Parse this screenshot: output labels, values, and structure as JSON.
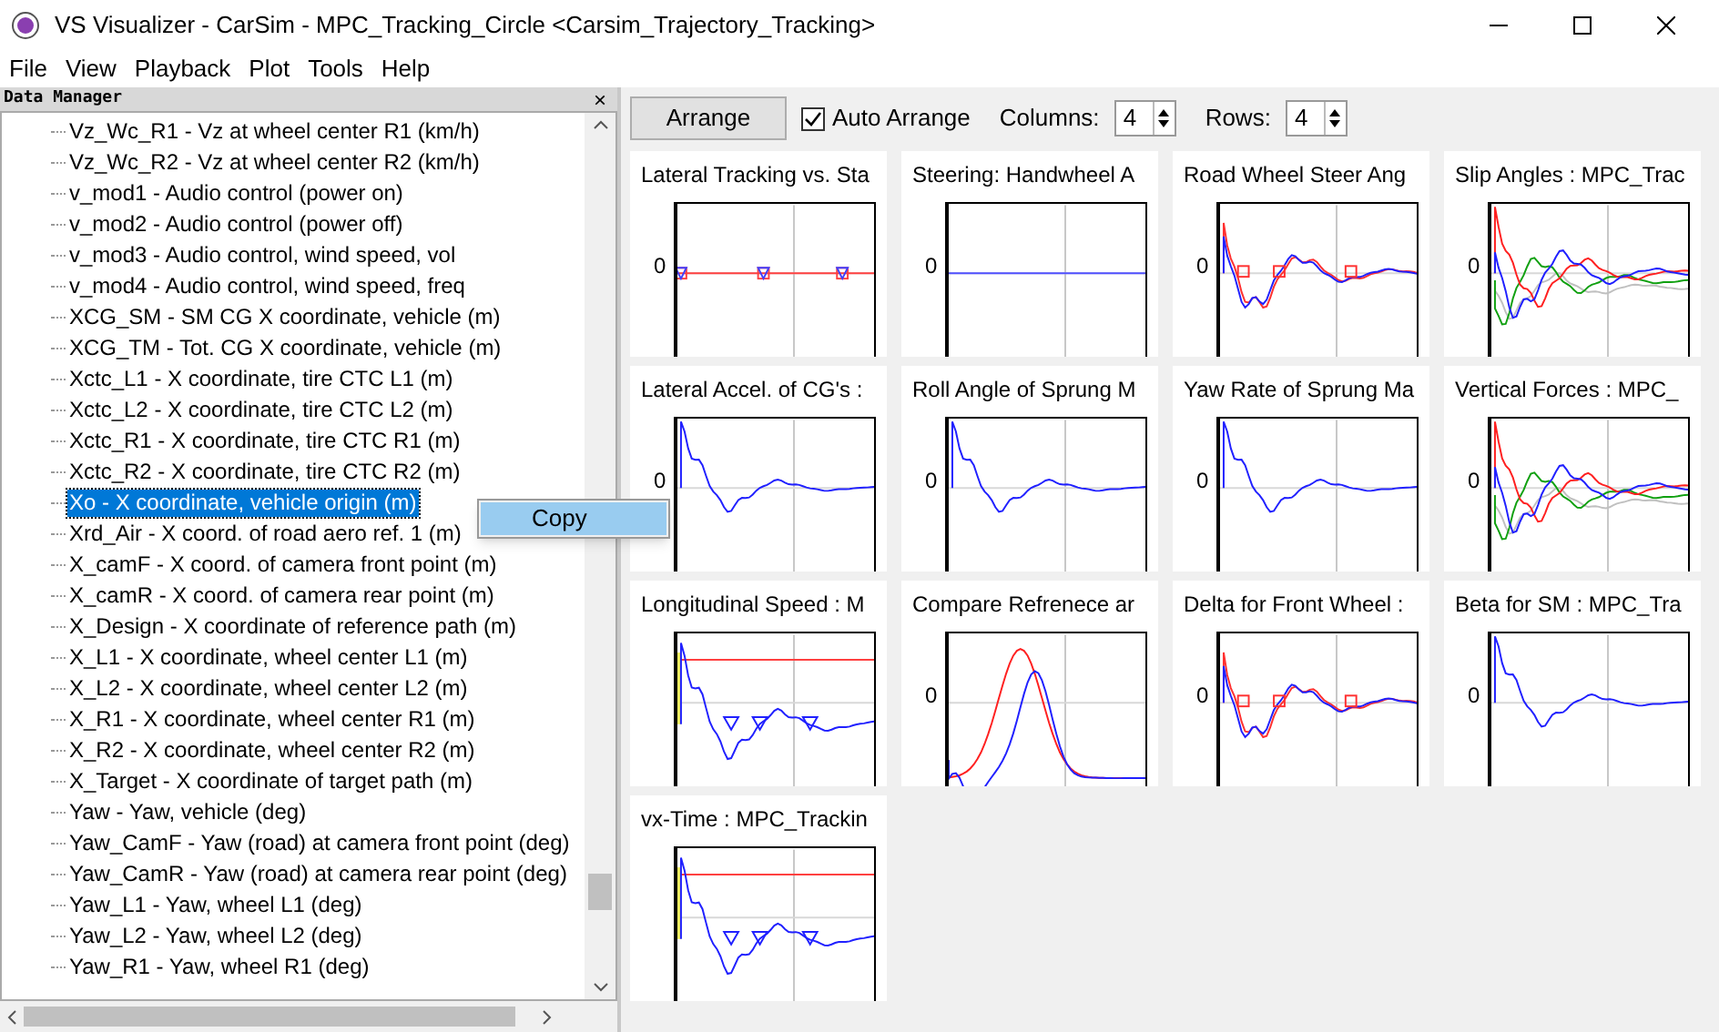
{
  "window": {
    "title": "VS Visualizer - CarSim - MPC_Tracking_Circle <Carsim_Trajectory_Tracking>"
  },
  "menu": [
    "File",
    "View",
    "Playback",
    "Plot",
    "Tools",
    "Help"
  ],
  "data_manager": {
    "title": "Data Manager",
    "close": "×",
    "items": [
      {
        "label": "Vz_Wc_R1 - Vz at wheel center R1 (km/h)",
        "selected": false
      },
      {
        "label": "Vz_Wc_R2 - Vz at wheel center R2 (km/h)",
        "selected": false
      },
      {
        "label": "v_mod1 - Audio control (power on)",
        "selected": false
      },
      {
        "label": "v_mod2 - Audio control (power off)",
        "selected": false
      },
      {
        "label": "v_mod3 - Audio control, wind speed, vol",
        "selected": false
      },
      {
        "label": "v_mod4 - Audio control, wind speed, freq",
        "selected": false
      },
      {
        "label": "XCG_SM - SM CG X coordinate, vehicle (m)",
        "selected": false
      },
      {
        "label": "XCG_TM - Tot. CG X coordinate, vehicle (m)",
        "selected": false
      },
      {
        "label": "Xctc_L1 - X coordinate, tire CTC L1 (m)",
        "selected": false
      },
      {
        "label": "Xctc_L2 - X coordinate, tire CTC L2 (m)",
        "selected": false
      },
      {
        "label": "Xctc_R1 - X coordinate, tire CTC R1 (m)",
        "selected": false
      },
      {
        "label": "Xctc_R2 - X coordinate, tire CTC R2 (m)",
        "selected": false
      },
      {
        "label": "Xo - X coordinate, vehicle origin (m)",
        "selected": true
      },
      {
        "label": "Xrd_Air - X coord. of road aero ref. 1 (m)",
        "selected": false
      },
      {
        "label": "X_camF - X coord. of camera front point (m)",
        "selected": false
      },
      {
        "label": "X_camR - X coord. of camera rear point (m)",
        "selected": false
      },
      {
        "label": "X_Design - X coordinate of reference path (m)",
        "selected": false
      },
      {
        "label": "X_L1 - X coordinate, wheel center L1 (m)",
        "selected": false
      },
      {
        "label": "X_L2 - X coordinate, wheel center L2 (m)",
        "selected": false
      },
      {
        "label": "X_R1 - X coordinate, wheel center R1 (m)",
        "selected": false
      },
      {
        "label": "X_R2 - X coordinate, wheel center R2 (m)",
        "selected": false
      },
      {
        "label": "X_Target - X coordinate of target path (m)",
        "selected": false
      },
      {
        "label": "Yaw - Yaw, vehicle (deg)",
        "selected": false
      },
      {
        "label": "Yaw_CamF - Yaw (road) at camera front point (deg)",
        "selected": false
      },
      {
        "label": "Yaw_CamR - Yaw (road) at camera rear point (deg)",
        "selected": false
      },
      {
        "label": "Yaw_L1 - Yaw, wheel L1 (deg)",
        "selected": false
      },
      {
        "label": "Yaw_L2 - Yaw, wheel L2 (deg)",
        "selected": false
      },
      {
        "label": "Yaw_R1 - Yaw, wheel R1 (deg)",
        "selected": false
      }
    ]
  },
  "context_menu": {
    "items": [
      "Copy"
    ]
  },
  "toolbar": {
    "arrange": "Arrange",
    "auto_arrange": {
      "label": "Auto Arrange",
      "checked": true
    },
    "columns": {
      "label": "Columns:",
      "value": "4"
    },
    "rows": {
      "label": "Rows:",
      "value": "4"
    }
  },
  "plots": [
    {
      "title": "Lateral Tracking vs. Sta",
      "zero_label": "0",
      "kind": "flat-marked"
    },
    {
      "title": "Steering: Handwheel A",
      "zero_label": "0",
      "kind": "flat"
    },
    {
      "title": "Road Wheel Steer Ang",
      "zero_label": "0",
      "kind": "damped-pair"
    },
    {
      "title": "Slip Angles : MPC_Trac",
      "zero_label": "0",
      "kind": "multi"
    },
    {
      "title": "Lateral Accel. of CG's :",
      "zero_label": "0",
      "kind": "damped"
    },
    {
      "title": "Roll Angle of Sprung M",
      "zero_label": "0",
      "kind": "damped"
    },
    {
      "title": "Yaw Rate of Sprung Ma",
      "zero_label": "0",
      "kind": "damped"
    },
    {
      "title": "Vertical Forces : MPC_",
      "zero_label": "0",
      "kind": "multi"
    },
    {
      "title": "Longitudinal Speed : M",
      "kind": "speed"
    },
    {
      "title": "Compare Refrenece ar",
      "zero_label": "0",
      "kind": "bump"
    },
    {
      "title": "Delta for Front Wheel :",
      "zero_label": "0",
      "kind": "damped-pair"
    },
    {
      "title": "Beta for SM : MPC_Tra",
      "zero_label": "0",
      "kind": "damped"
    },
    {
      "title": "vx-Time : MPC_Trackin",
      "kind": "speed"
    }
  ]
}
